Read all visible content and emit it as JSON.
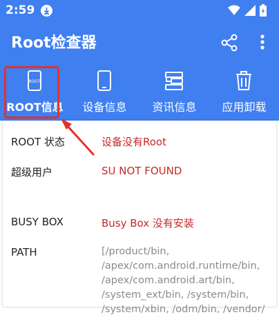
{
  "status": {
    "time": "2:59"
  },
  "app": {
    "title": "Root检查器"
  },
  "tabs": [
    {
      "label": "ROOT信息",
      "icon": "root-phone-icon"
    },
    {
      "label": "设备信息",
      "icon": "phone-icon"
    },
    {
      "label": "资讯信息",
      "icon": "info-list-icon"
    },
    {
      "label": "应用卸载",
      "icon": "trash-icon"
    }
  ],
  "rows": [
    {
      "label": "ROOT 状态",
      "value": "设备没有Root"
    },
    {
      "label": "超级用户",
      "value": "SU NOT FOUND"
    },
    {
      "label": "BUSY BOX",
      "value": "Busy Box 没有安装"
    },
    {
      "label": "PATH",
      "value": "[/product/bin, /apex/com.android.runtime/bin, /apex/com.android.art/bin, /system_ext/bin, /system/bin, /system/xbin, /odm/bin, /vendor/"
    }
  ],
  "colors": {
    "primary": "#3f7ff0",
    "highlight": "#e3312a",
    "value_red": "#c62828"
  }
}
